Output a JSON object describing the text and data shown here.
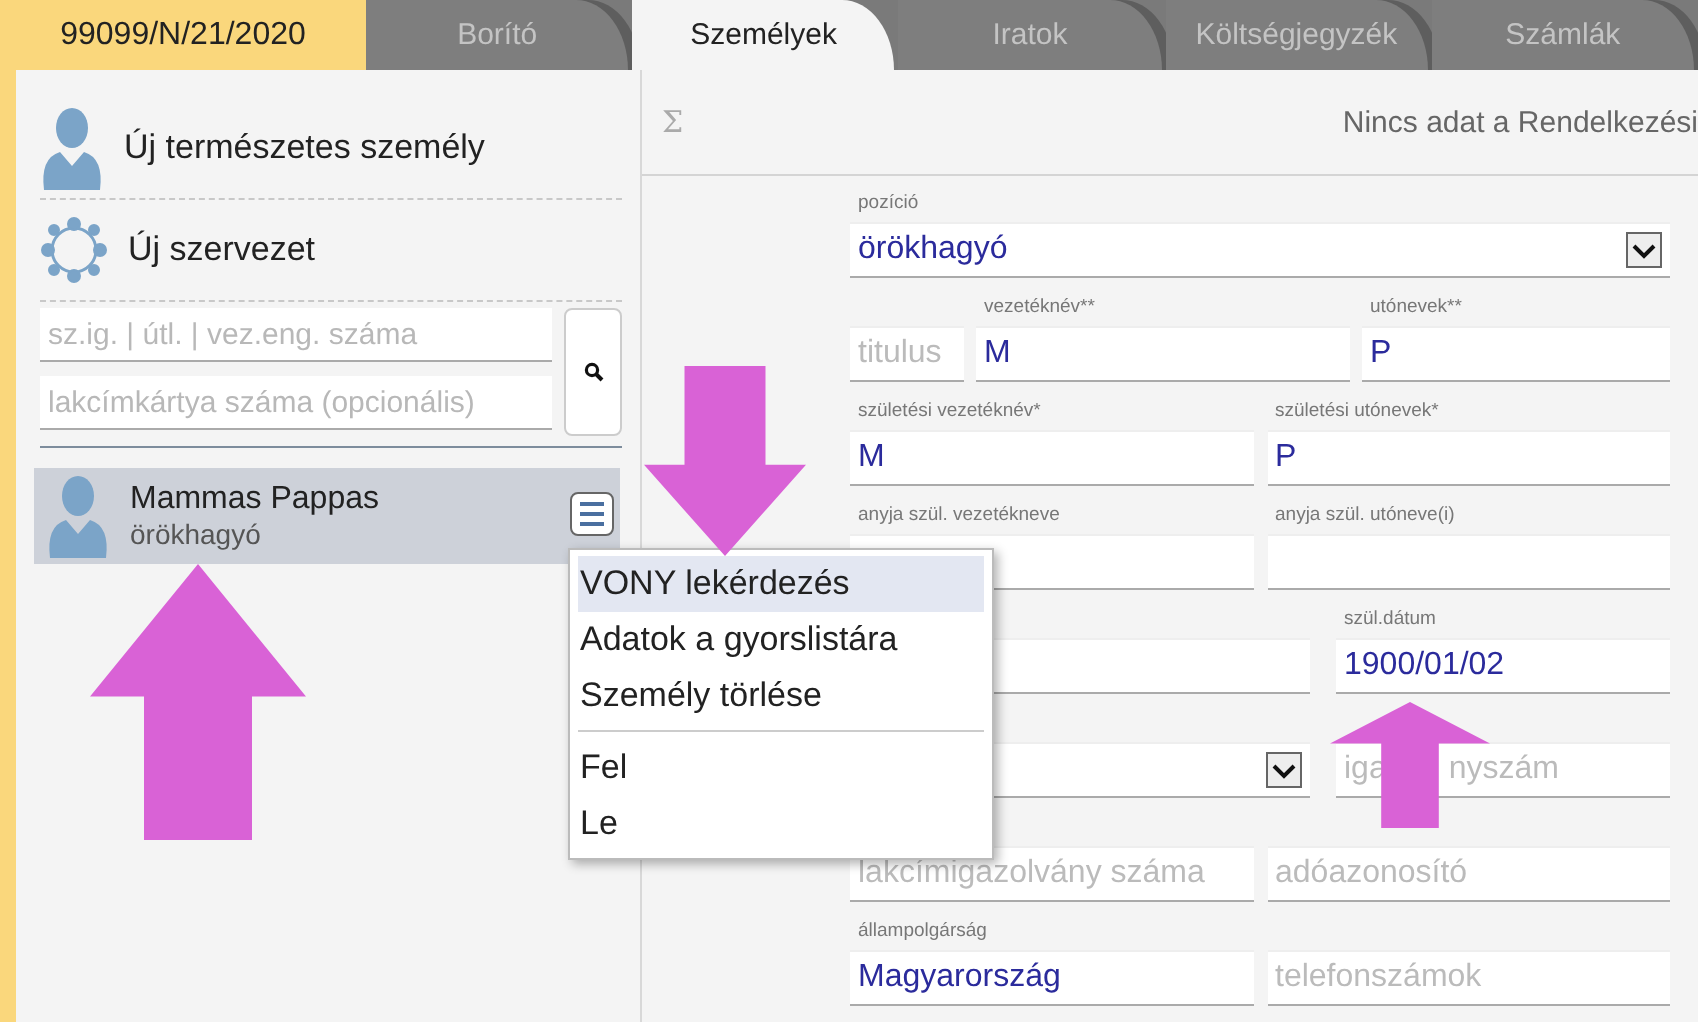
{
  "case_tab": {
    "label": "99099/N/21/2020"
  },
  "tabs": [
    {
      "label": "Borító",
      "selected": false
    },
    {
      "label": "Személyek",
      "selected": true
    },
    {
      "label": "Iratok",
      "selected": false
    },
    {
      "label": "Költségjegyzék",
      "selected": false
    },
    {
      "label": "Számlák",
      "selected": false
    }
  ],
  "sidebar": {
    "actions": [
      {
        "kind": "person",
        "label": "Új természetes személy"
      },
      {
        "kind": "organization",
        "label": "Új szervezet"
      }
    ],
    "search_fields": [
      {
        "placeholder": "sz.ig. | útl. | vez.eng. száma"
      },
      {
        "placeholder": "lakcímkártya száma (opcionális)"
      }
    ],
    "persons": [
      {
        "name": "Mammas Pappas",
        "role": "örökhagyó",
        "selected": true
      }
    ]
  },
  "context_menu": {
    "groups": [
      [
        {
          "label": "VONY lekérdezés",
          "selected": true
        },
        {
          "label": "Adatok a gyorslistára",
          "selected": false
        },
        {
          "label": "Személy törlése",
          "selected": false
        }
      ],
      [
        {
          "label": "Fel",
          "selected": false
        },
        {
          "label": "Le",
          "selected": false
        }
      ]
    ]
  },
  "main": {
    "sum_symbol": "Σ",
    "message": "Nincs adat a Rendelkezési",
    "form_rows": [
      {
        "kind": "single",
        "fields": [
          {
            "kind": "select",
            "label": "pozíció",
            "value": "örökhagyó"
          }
        ]
      },
      {
        "kind": "name",
        "fields": [
          {
            "kind": "text",
            "placeholder": "titulus"
          },
          {
            "kind": "text",
            "label": "vezetéknév**",
            "value": "M"
          },
          {
            "kind": "text",
            "label": "utónevek**",
            "value": "P"
          }
        ]
      },
      {
        "kind": "halves",
        "fields": [
          {
            "kind": "text",
            "label": "születési vezetéknév*",
            "value": "M"
          },
          {
            "kind": "text",
            "label": "születési utónevek*",
            "value": "P"
          }
        ]
      },
      {
        "kind": "halves",
        "fields": [
          {
            "kind": "text",
            "label": "anyja szül. vezetékneve"
          },
          {
            "kind": "text",
            "label": "anyja szül. utóneve(i)"
          }
        ]
      },
      {
        "kind": "wide-left",
        "fields": [
          {
            "kind": "text"
          },
          {
            "kind": "text",
            "label": "szül.dátum",
            "value": "1900/01/02"
          }
        ]
      },
      {
        "kind": "wide-left",
        "fields": [
          {
            "kind": "select"
          },
          {
            "kind": "text",
            "placeholder_parts": [
              "iga",
              "nyszám"
            ]
          }
        ]
      },
      {
        "kind": "halves",
        "fields": [
          {
            "kind": "text",
            "placeholder": "lakcímigazolvány száma"
          },
          {
            "kind": "text",
            "placeholder": "adóazonosító"
          }
        ]
      },
      {
        "kind": "halves",
        "fields": [
          {
            "kind": "text",
            "label": "állampolgárság",
            "value": "Magyarország"
          },
          {
            "kind": "text",
            "placeholder": "telefonszámok"
          }
        ]
      }
    ]
  },
  "annotations": [
    {
      "kind": "down"
    },
    {
      "kind": "up"
    },
    {
      "kind": "up"
    }
  ]
}
